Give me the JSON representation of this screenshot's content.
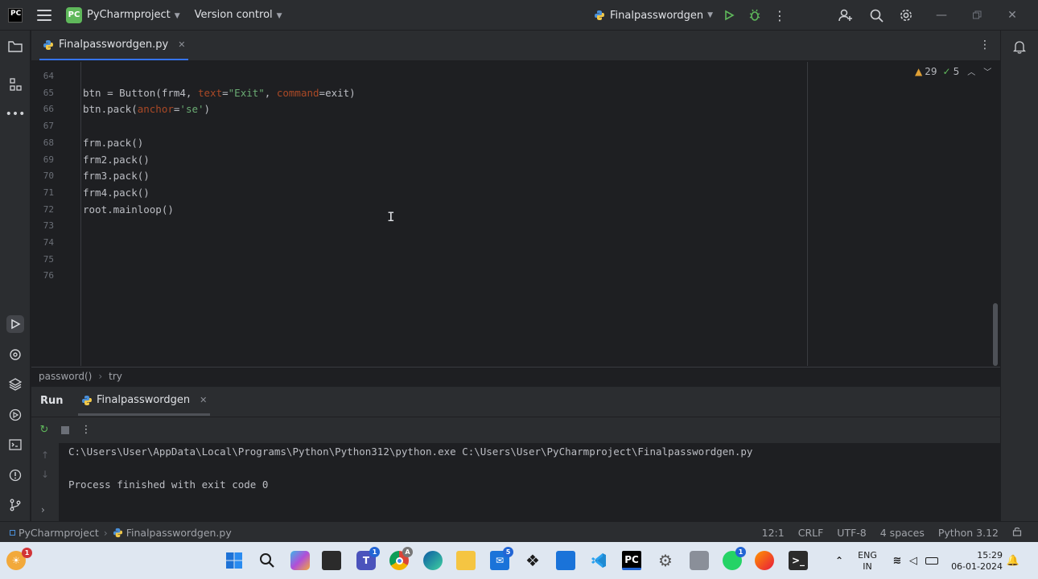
{
  "titlebar": {
    "logo": "PC",
    "project_badge": "PC",
    "project": "PyCharmproject",
    "vcs": "Version control",
    "run_config": "Finalpasswordgen"
  },
  "tabs": [
    {
      "label": "Finalpasswordgen.py"
    }
  ],
  "editor": {
    "lines": [
      {
        "n": "64",
        "code": ""
      },
      {
        "n": "65",
        "code": "btn = Button(frm4, text=\"Exit\", command=exit)"
      },
      {
        "n": "66",
        "code": "btn.pack(anchor='se')"
      },
      {
        "n": "67",
        "code": ""
      },
      {
        "n": "68",
        "code": "frm.pack()"
      },
      {
        "n": "69",
        "code": "frm2.pack()"
      },
      {
        "n": "70",
        "code": "frm3.pack()"
      },
      {
        "n": "71",
        "code": "frm4.pack()"
      },
      {
        "n": "72",
        "code": "root.mainloop()"
      },
      {
        "n": "73",
        "code": ""
      },
      {
        "n": "74",
        "code": ""
      },
      {
        "n": "75",
        "code": ""
      },
      {
        "n": "76",
        "code": ""
      }
    ],
    "warnings": "29",
    "ok_count": "5"
  },
  "breadcrumb": [
    "password()",
    "try"
  ],
  "run_panel": {
    "title": "Run",
    "tab": "Finalpasswordgen",
    "output": [
      "C:\\Users\\User\\AppData\\Local\\Programs\\Python\\Python312\\python.exe C:\\Users\\User\\PyCharmproject\\Finalpasswordgen.py",
      "",
      "Process finished with exit code 0"
    ]
  },
  "statusbar": {
    "project": "PyCharmproject",
    "file": "Finalpasswordgen.py",
    "position": "12:1",
    "line_sep": "CRLF",
    "encoding": "UTF-8",
    "indent": "4 spaces",
    "interpreter": "Python 3.12"
  },
  "taskbar": {
    "weather_badge": "1",
    "teams_badge": "1",
    "mail_badge": "5",
    "whatsapp_badge": "1",
    "chrome_badge": "A",
    "lang_line1": "ENG",
    "lang_line2": "IN",
    "time": "15:29",
    "date": "06-01-2024"
  },
  "colors": {
    "accent": "#3574f0",
    "keyword": "#cf8e6d",
    "string": "#6aab73",
    "param": "#aa4926",
    "project_badge": "#5fb85b"
  }
}
